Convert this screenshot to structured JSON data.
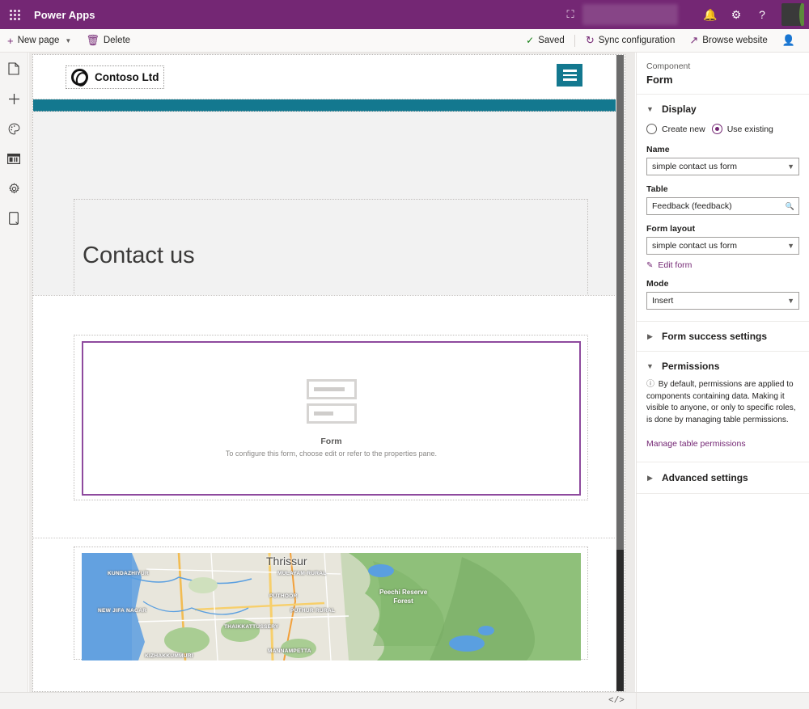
{
  "topbar": {
    "waffle_icon": "waffle-grid-icon",
    "app_title": "Power Apps",
    "env_icon": "environment-icon",
    "notification_icon": "bell-icon",
    "settings_icon": "gear-icon",
    "help_icon": "help-icon",
    "avatar": "user-avatar",
    "brand_color": "#742774"
  },
  "commandbar": {
    "new_page": "New page",
    "new_page_icon": "plus-icon",
    "new_page_chevron": "chevron-down-icon",
    "delete": "Delete",
    "delete_icon": "trash-icon",
    "saved": "Saved",
    "saved_icon": "checkmark-icon",
    "sync_configuration": "Sync configuration",
    "sync_icon": "refresh-icon",
    "browse_website": "Browse website",
    "browse_icon": "external-window-icon",
    "share_icon": "share-person-icon"
  },
  "leftrail": {
    "items": [
      {
        "name": "pages",
        "icon": "page-icon"
      },
      {
        "name": "add",
        "icon": "plus-icon"
      },
      {
        "name": "styling",
        "icon": "palette-icon"
      },
      {
        "name": "data",
        "icon": "data-workspace-icon"
      },
      {
        "name": "settings",
        "icon": "gear-icon"
      },
      {
        "name": "mobile-preview",
        "icon": "mobile-device-icon"
      }
    ]
  },
  "canvas": {
    "site_header": {
      "logo_text": "Contoso Ltd",
      "logo_icon": "contoso-ring-logo",
      "menu_icon": "hamburger-menu-icon",
      "accent_color": "#13788f"
    },
    "hero": {
      "title": "Contact us"
    },
    "form_placeholder": {
      "icon": "form-placeholder-icon",
      "title": "Form",
      "subtitle": "To configure this form, choose edit or refer to the properties pane.",
      "selection_color": "#8e4a9e"
    },
    "map": {
      "city_label": "Thrissur",
      "forest_label": "Peechi Reserve\nForest",
      "place_labels": [
        "KUNDAZHIYUR",
        "MULAYAM RURAL",
        "NEW JIFA NAGAR",
        "PUTHOOR",
        "PUTHUR RURAL",
        "THAIKKATTUSSERY",
        "MANNAMPETTA",
        "KIZHAKKUMMURI"
      ]
    }
  },
  "pane": {
    "kicker": "Component",
    "title": "Form",
    "display": {
      "section_label": "Display",
      "chevron": "chevron-down-icon",
      "radio_create_new": "Create new",
      "radio_use_existing": "Use existing",
      "selected_radio": "Use existing",
      "name_label": "Name",
      "name_value": "simple contact us form",
      "name_chevron": "chevron-down-icon",
      "table_label": "Table",
      "table_value": "Feedback (feedback)",
      "table_icon": "search-icon",
      "form_layout_label": "Form layout",
      "form_layout_value": "simple contact us form",
      "form_layout_chevron": "chevron-down-icon",
      "edit_form_link": "Edit form",
      "edit_form_icon": "pencil-icon",
      "mode_label": "Mode",
      "mode_value": "Insert",
      "mode_chevron": "chevron-down-icon"
    },
    "form_success": {
      "section_label": "Form success settings",
      "chevron": "chevron-right-icon"
    },
    "permissions": {
      "section_label": "Permissions",
      "chevron": "chevron-down-icon",
      "info_icon": "info-icon",
      "note": "By default, permissions are applied to components containing data. Making it visible to anyone, or only to specific roles, is done by managing table permissions.",
      "manage_link": "Manage table permissions"
    },
    "advanced": {
      "section_label": "Advanced settings",
      "chevron": "chevron-right-icon"
    }
  },
  "bottombar": {
    "code_icon": "code-editor-icon",
    "code_glyph": "</>"
  }
}
